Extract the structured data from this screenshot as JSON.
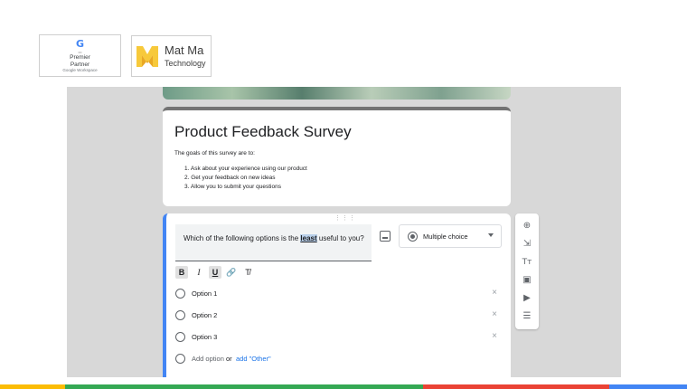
{
  "badges": {
    "google": {
      "logo_letter": "G",
      "line1": "Premier",
      "line2": "Partner",
      "line3": "Google Workspace"
    },
    "matma": {
      "name": "Mat Ma",
      "subtitle": "Technology"
    }
  },
  "form": {
    "title": "Product Feedback Survey",
    "description": "The goals of this survey are to:",
    "goals": [
      "1. Ask about your experience using our product",
      "2. Get your feedback on new ideas",
      "3. Allow you to submit your questions"
    ]
  },
  "question": {
    "drag_handle": "⋮⋮⋮",
    "text_before": "Which of the following options is the ",
    "text_highlight": "least",
    "text_after": " useful to you?",
    "type": "Multiple choice",
    "format_buttons": [
      "B",
      "I",
      "U",
      "🔗",
      "T̸"
    ],
    "options": [
      {
        "label": "Option 1",
        "remove": "×"
      },
      {
        "label": "Option 2",
        "remove": "×"
      },
      {
        "label": "Option 3",
        "remove": "×"
      }
    ],
    "add_option": "Add option",
    "add_or": "or",
    "add_other": "add \"Other\""
  },
  "tools": [
    "⊕",
    "⇲",
    "Tт",
    "▣",
    "▶",
    "☰"
  ],
  "colors": {
    "accent_blue": "#4285f4",
    "google_yellow": "#fbbc04",
    "google_green": "#34a853",
    "google_red": "#ea4335",
    "matma_yellow": "#f7c93b"
  }
}
